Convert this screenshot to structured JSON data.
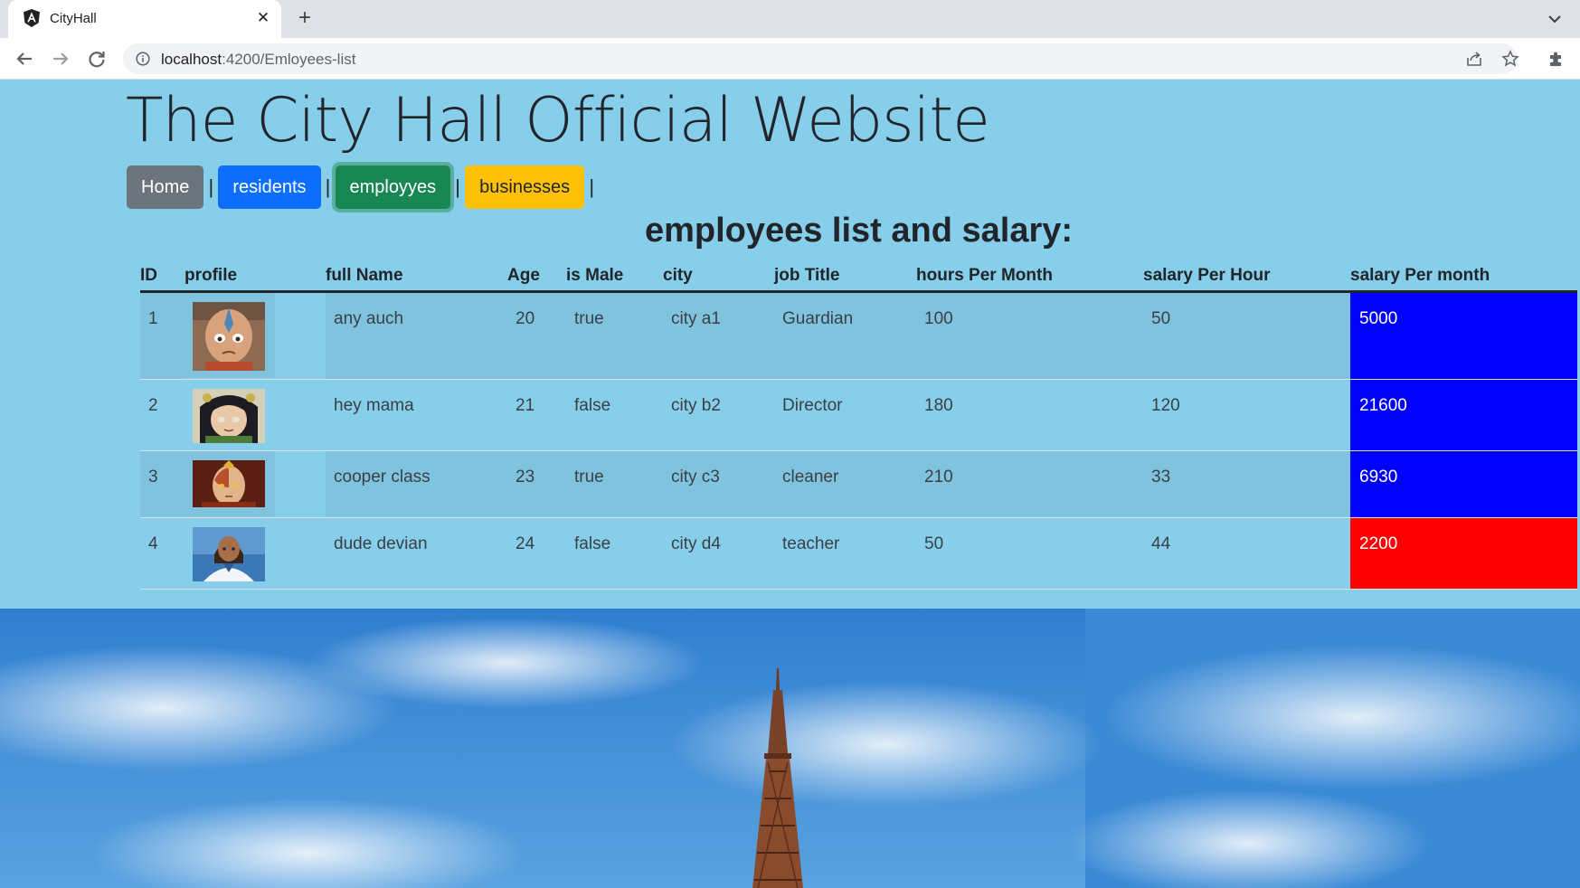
{
  "browser": {
    "tab_title": "CityHall",
    "url_host": "localhost",
    "url_path": ":4200/Emloyees-list",
    "new_tab_symbol": "+",
    "close_symbol": "✕"
  },
  "page": {
    "title": "The City Hall Official Website",
    "section_title": "employees list and salary:"
  },
  "nav": {
    "separator": "|",
    "items": [
      {
        "label": "Home",
        "color": "#6c757d"
      },
      {
        "label": "residents",
        "color": "#0d6efd"
      },
      {
        "label": "employyes",
        "color": "#198754",
        "active": true
      },
      {
        "label": "businesses",
        "color": "#ffc107"
      }
    ]
  },
  "table": {
    "columns": [
      "ID",
      "profile",
      "full Name",
      "Age",
      "is Male",
      "city",
      "job Title",
      "hours Per Month",
      "salary Per Hour",
      "salary Per month"
    ],
    "rows": [
      {
        "id": "1",
        "avatar": "avatar-aang-icon",
        "full_name": "any auch",
        "age": "20",
        "is_male": "true",
        "city": "city a1",
        "job_title": "Guardian",
        "hours_per_month": "100",
        "salary_per_hour": "50",
        "salary_per_month": "5000",
        "salary_color": "#0000ff"
      },
      {
        "id": "2",
        "avatar": "avatar-toph-icon",
        "full_name": "hey mama",
        "age": "21",
        "is_male": "false",
        "city": "city b2",
        "job_title": "Director",
        "hours_per_month": "180",
        "salary_per_hour": "120",
        "salary_per_month": "21600",
        "salary_color": "#0000ff"
      },
      {
        "id": "3",
        "avatar": "avatar-zuko-icon",
        "full_name": "cooper class",
        "age": "23",
        "is_male": "true",
        "city": "city c3",
        "job_title": "cleaner",
        "hours_per_month": "210",
        "salary_per_hour": "33",
        "salary_per_month": "6930",
        "salary_color": "#0000ff"
      },
      {
        "id": "4",
        "avatar": "avatar-katara-icon",
        "full_name": "dude devian",
        "age": "24",
        "is_male": "false",
        "city": "city d4",
        "job_title": "teacher",
        "hours_per_month": "50",
        "salary_per_hour": "44",
        "salary_per_month": "2200",
        "salary_color": "#ff0000"
      }
    ]
  },
  "colors": {
    "page_background": "#87ceeb",
    "text": "#212529"
  }
}
